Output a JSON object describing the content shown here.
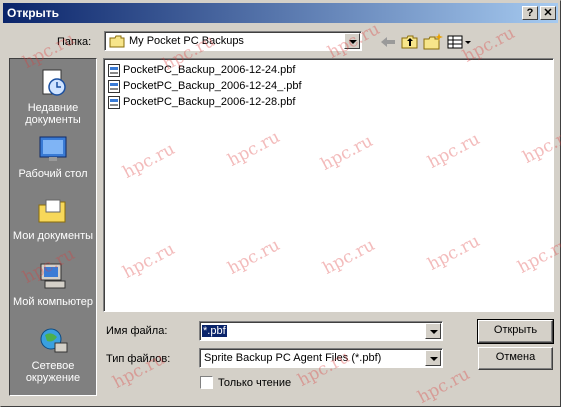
{
  "window": {
    "title": "Открыть"
  },
  "titlebar_buttons": {
    "help": "?",
    "close": "✕"
  },
  "folder_bar": {
    "label": "Папка:",
    "current_folder": "My Pocket PC Backups",
    "tools": [
      "back-icon",
      "up-folder-icon",
      "new-folder-icon",
      "view-menu-icon"
    ]
  },
  "places": [
    {
      "label": "Недавние документы",
      "icon": "recent-documents-icon"
    },
    {
      "label": "Рабочий стол",
      "icon": "desktop-icon"
    },
    {
      "label": "Мои документы",
      "icon": "my-documents-icon"
    },
    {
      "label": "Мой компьютер",
      "icon": "my-computer-icon"
    },
    {
      "label": "Сетевое окружение",
      "icon": "network-places-icon"
    }
  ],
  "files": [
    "PocketPC_Backup_2006-12-24.pbf",
    "PocketPC_Backup_2006-12-24_.pbf",
    "PocketPC_Backup_2006-12-28.pbf"
  ],
  "filename": {
    "label": "Имя файла:",
    "value": "*.pbf"
  },
  "filetype": {
    "label": "Тип файлов:",
    "value": "Sprite Backup PC Agent Files (*.pbf)"
  },
  "readonly_checkbox": {
    "label": "Только чтение",
    "checked": false
  },
  "buttons": {
    "open": "Открыть",
    "cancel": "Отмена"
  },
  "watermark": "hpc.ru",
  "colors": {
    "titlebar_start": "#0a246a",
    "titlebar_end": "#a6caf0",
    "face": "#d4d0c8",
    "places_bg": "#808080",
    "watermark": "#dc3c3c"
  }
}
